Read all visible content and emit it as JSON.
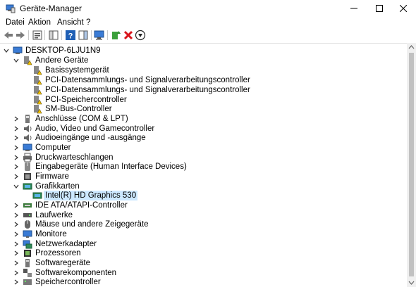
{
  "window": {
    "title": "Geräte-Manager"
  },
  "menu": [
    {
      "label": "Datei"
    },
    {
      "label": "Aktion"
    },
    {
      "label": "Ansicht"
    },
    {
      "label": "?"
    }
  ],
  "toolbar": [
    {
      "icon": "back-arrow-icon"
    },
    {
      "icon": "forward-arrow-icon"
    },
    {
      "icon": "properties-icon"
    },
    {
      "icon": "show-hide-console-tree-icon"
    },
    {
      "icon": "help-icon"
    },
    {
      "icon": "action-pane-icon"
    },
    {
      "icon": "scan-hardware-changes-icon"
    },
    {
      "icon": "update-driver-icon"
    },
    {
      "icon": "uninstall-device-icon"
    },
    {
      "icon": "disable-device-icon"
    }
  ],
  "tree": {
    "root": {
      "label": "DESKTOP-6LJU1N9",
      "expanded": true
    },
    "categories": [
      {
        "label": "Andere Geräte",
        "expanded": true,
        "icon": "warning-device-icon",
        "children": [
          {
            "label": "Basissystemgerät",
            "icon": "warning-device-icon"
          },
          {
            "label": "PCI-Datensammlungs- und Signalverarbeitungscontroller",
            "icon": "warning-device-icon"
          },
          {
            "label": "PCI-Datensammlungs- und Signalverarbeitungscontroller",
            "icon": "warning-device-icon"
          },
          {
            "label": "PCI-Speichercontroller",
            "icon": "warning-device-icon"
          },
          {
            "label": "SM-Bus-Controller",
            "icon": "warning-device-icon"
          }
        ]
      },
      {
        "label": "Anschlüsse (COM & LPT)",
        "expanded": false,
        "icon": "port-icon"
      },
      {
        "label": "Audio, Video und Gamecontroller",
        "expanded": false,
        "icon": "speaker-icon"
      },
      {
        "label": "Audioeingänge und -ausgänge",
        "expanded": false,
        "icon": "speaker-icon"
      },
      {
        "label": "Computer",
        "expanded": false,
        "icon": "computer-icon"
      },
      {
        "label": "Druckwarteschlangen",
        "expanded": false,
        "icon": "printer-icon"
      },
      {
        "label": "Eingabegeräte (Human Interface Devices)",
        "expanded": false,
        "icon": "hid-icon"
      },
      {
        "label": "Firmware",
        "expanded": false,
        "icon": "firmware-icon"
      },
      {
        "label": "Grafikkarten",
        "expanded": true,
        "icon": "display-adapter-icon",
        "children": [
          {
            "label": "Intel(R) HD Graphics 530",
            "icon": "display-adapter-icon",
            "selected": true
          }
        ]
      },
      {
        "label": "IDE ATA/ATAPI-Controller",
        "expanded": false,
        "icon": "ide-controller-icon"
      },
      {
        "label": "Laufwerke",
        "expanded": false,
        "icon": "drive-icon"
      },
      {
        "label": "Mäuse und andere Zeigegeräte",
        "expanded": false,
        "icon": "mouse-icon"
      },
      {
        "label": "Monitore",
        "expanded": false,
        "icon": "monitor-icon"
      },
      {
        "label": "Netzwerkadapter",
        "expanded": false,
        "icon": "network-adapter-icon"
      },
      {
        "label": "Prozessoren",
        "expanded": false,
        "icon": "processor-icon"
      },
      {
        "label": "Softwaregeräte",
        "expanded": false,
        "icon": "software-device-icon"
      },
      {
        "label": "Softwarekomponenten",
        "expanded": false,
        "icon": "software-component-icon"
      },
      {
        "label": "Speichercontroller",
        "expanded": false,
        "icon": "storage-controller-icon"
      }
    ]
  }
}
